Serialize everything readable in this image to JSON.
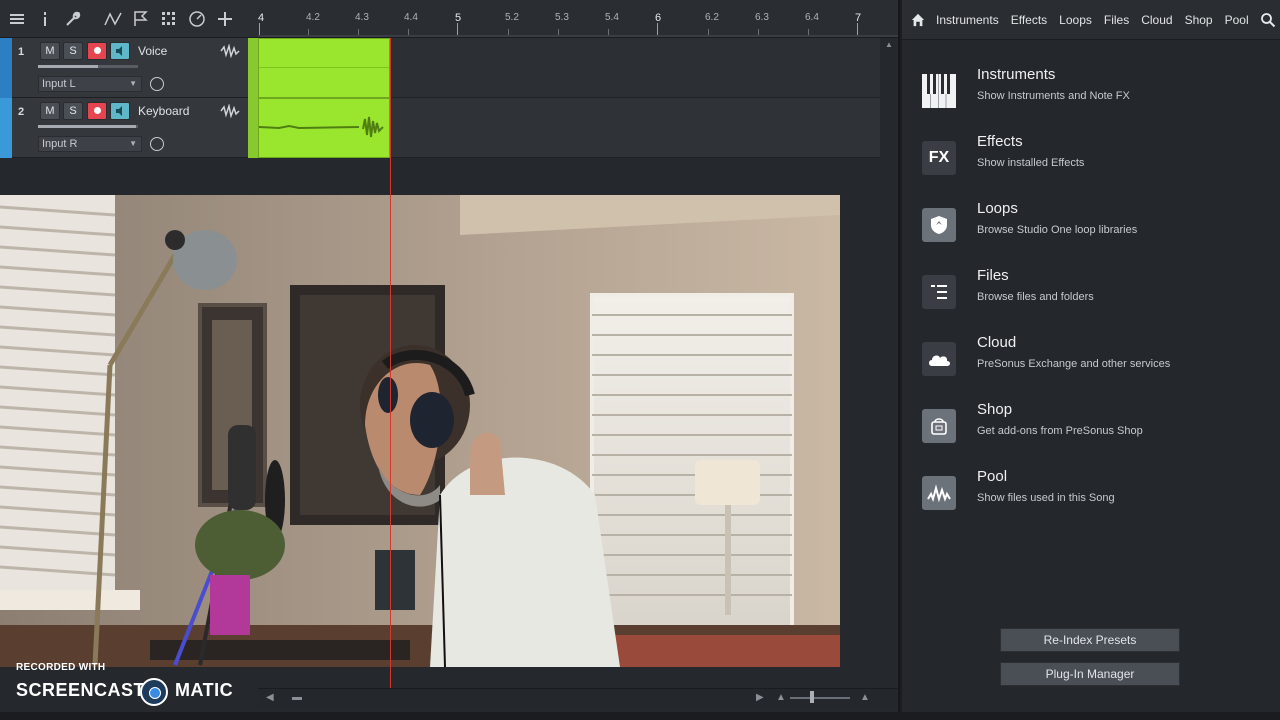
{
  "toolbar": {
    "icons": [
      "menu-icon",
      "info-icon",
      "wrench-icon",
      "automation-curve-icon",
      "flag-icon",
      "grid-snap-icon",
      "metronome-icon",
      "add-icon"
    ]
  },
  "ruler": {
    "labels": [
      "4",
      "4.2",
      "4.3",
      "4.4",
      "5",
      "5.2",
      "5.3",
      "5.4",
      "6",
      "6.2",
      "6.3",
      "6.4",
      "7"
    ]
  },
  "tracks": [
    {
      "number": "1",
      "mute": "M",
      "solo": "S",
      "name": "Voice",
      "input": "Input L"
    },
    {
      "number": "2",
      "mute": "M",
      "solo": "S",
      "name": "Keyboard",
      "input": "Input R"
    }
  ],
  "watermark": {
    "small": "RECORDED WITH",
    "part1": "SCREENCAST",
    "part2": "MATIC"
  },
  "browser": {
    "tabs": [
      "Instruments",
      "Effects",
      "Loops",
      "Files",
      "Cloud",
      "Shop",
      "Pool"
    ],
    "items": [
      {
        "title": "Instruments",
        "desc": "Show Instruments and Note FX",
        "icon": "piano-keys-icon"
      },
      {
        "title": "Effects",
        "desc": "Show installed Effects",
        "icon": "fx-icon",
        "icon_text": "FX"
      },
      {
        "title": "Loops",
        "desc": "Browse Studio One loop libraries",
        "icon": "loops-shield-icon"
      },
      {
        "title": "Files",
        "desc": "Browse files and folders",
        "icon": "files-icon"
      },
      {
        "title": "Cloud",
        "desc": "PreSonus Exchange and other services",
        "icon": "cloud-icon"
      },
      {
        "title": "Shop",
        "desc": "Get add-ons from PreSonus Shop",
        "icon": "shop-bag-icon"
      },
      {
        "title": "Pool",
        "desc": "Show files used in this Song",
        "icon": "pool-waveform-icon"
      }
    ],
    "buttons": {
      "reindex": "Re-Index Presets",
      "plugin_manager": "Plug-In Manager"
    }
  },
  "colors": {
    "clip_green": "#9ae62f",
    "record_red": "#e5454f",
    "monitor_cyan": "#5fb8c9",
    "track_blue": "#2d7fc3",
    "playhead_red": "#d3382f"
  }
}
